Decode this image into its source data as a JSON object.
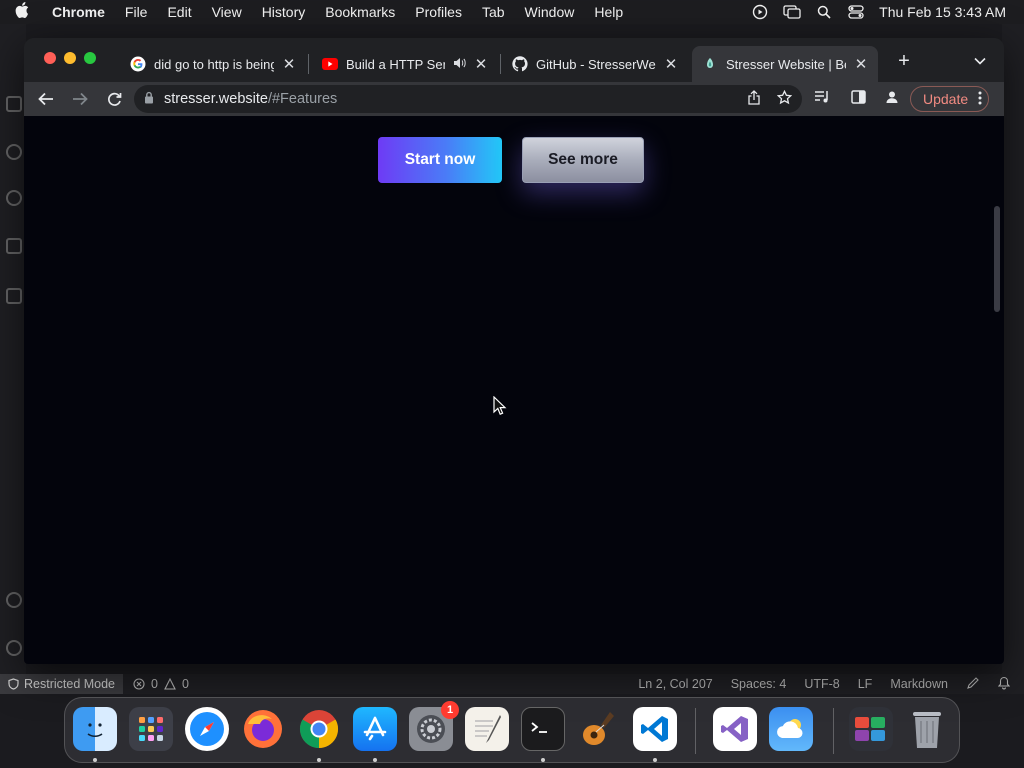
{
  "menubar": {
    "app_name": "Chrome",
    "items": [
      "File",
      "Edit",
      "View",
      "History",
      "Bookmarks",
      "Profiles",
      "Tab",
      "Window",
      "Help"
    ],
    "datetime": "Thu Feb 15  3:43 AM"
  },
  "browser": {
    "tabs": [
      {
        "title": "did go to http is being",
        "favicon": "google-icon"
      },
      {
        "title": "Build a HTTP Serv",
        "favicon": "youtube-icon",
        "audio": "speaker-icon"
      },
      {
        "title": "GitHub - StresserWebsit",
        "favicon": "github-icon"
      },
      {
        "title": "Stresser Website | Bes",
        "favicon": "site-icon",
        "active": true
      }
    ],
    "url": {
      "host": "stresser.website",
      "path": "/#Features"
    },
    "update_label": "Update"
  },
  "page": {
    "start_label": "Start now",
    "more_label": "See more",
    "colors": {
      "background": "#03040c",
      "start_from": "#6e3bf5",
      "start_to": "#22c8f7"
    }
  },
  "vscode_status": {
    "restricted": "Restricted Mode",
    "errors": "0",
    "warnings": "0",
    "position": "Ln 2, Col 207",
    "spaces": "Spaces: 4",
    "encoding": "UTF-8",
    "eol": "LF",
    "language": "Markdown"
  },
  "dock": {
    "apps": [
      "Finder",
      "Launchpad",
      "Safari",
      "Firefox",
      "Chrome",
      "App Store",
      "System Settings",
      "TextEdit",
      "Terminal",
      "GarageBand",
      "VS Code",
      "Visual Studio",
      "Weather",
      "Applications",
      "Trash"
    ],
    "settings_badge": "1"
  }
}
